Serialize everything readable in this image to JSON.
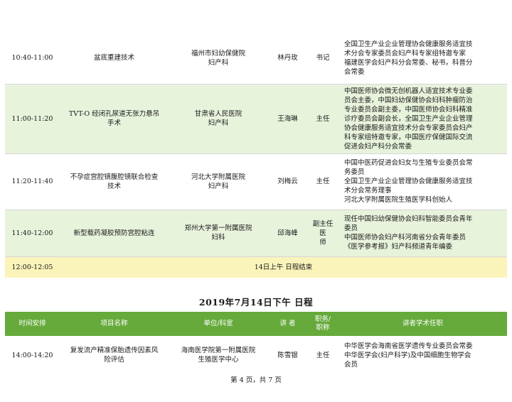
{
  "morning_rows": [
    {
      "time": "10:40-11:00",
      "topic": "盆底重建技术",
      "unit_1": "福州市妇幼保健院",
      "unit_2": "妇产科",
      "name": "林丹玫",
      "position_1": "书记",
      "position_2": "",
      "bio": [
        "全国卫生产业企业管理协会健康服务适宜技",
        "术分会专家委员会妇产科专家组特邀专家",
        "福建医学会妇产科分会常委、秘书，科普分",
        "会常委"
      ]
    },
    {
      "time": "11:00-11:20",
      "topic_1": "TVT-O 经闭孔尿道无张力悬吊",
      "topic_2": "手术",
      "unit_1": "甘肃省人民医院",
      "unit_2": "妇产科",
      "name": "王海琳",
      "position_1": "主任",
      "position_2": "",
      "bio": [
        "中国医师协会微无创机器人适宜技术专业委",
        "员会主委，中国妇幼保健协会妇科肿瘤防治",
        "专业委员会副主委，中国医师协会妇科精准",
        "诊疗委员会副会长，全国卫生产业企业管理",
        "协会健康服务适宜技术分会专家委员会妇产",
        "科专家组特邀专家，中国医疗保健国际交流",
        "促进会妇产科分会常委"
      ]
    },
    {
      "time": "11:20-11:40",
      "topic_1": "不孕症宫腔镜腹腔镜联合检查",
      "topic_2": "技术",
      "unit_1": "河北大学附属医院",
      "unit_2": "妇产科",
      "name": "刘梅云",
      "position_1": "主任",
      "position_2": "",
      "bio": [
        "中国中医药促进会妇女与生殖专业委员会常",
        "务委员",
        "全国卫生产业企业管理协会健康服务适宜技",
        "术分会常务理事",
        "河北大学附属医院生殖医学科创始人"
      ]
    },
    {
      "time": "11:40-12:00",
      "topic": "新型载药凝胶预防宫腔粘连",
      "unit_1": "郑州大学第一附属医院",
      "unit_2": "妇科",
      "name": "邱海峰",
      "position_1": "副主任医",
      "position_2": "师",
      "bio": [
        "现任中国妇幼保健协会妇科智能委员会青年",
        "委员",
        "中国医师协会妇产科河南省分会青年委员",
        "《医学参考报》妇产科频道青年编委"
      ]
    }
  ],
  "end_row": {
    "time": "12:00-12:05",
    "text": "14日上午 日程结束"
  },
  "afternoon_title": "2019年7月14日下午  日程",
  "header": {
    "time": "时间安排",
    "topic": "项目名称",
    "unit": "单位/科室",
    "name": "讲  者",
    "position_1": "职务/",
    "position_2": "职称",
    "bio": "讲者学术任职"
  },
  "afternoon_rows": [
    {
      "time": "14:00-14:20",
      "topic_1": "复发流产精准保胎遗传因素风",
      "topic_2": "险评估",
      "unit_1": "海南医学院第一附属医院",
      "unit_2": "生殖医学中心",
      "name": "陈雪银",
      "position_1": "主任",
      "position_2": "",
      "bio": [
        "中华医学会海南省医学遗传专业委员会常委",
        "中华医学会(妇产科学)及中国细胞生物学会",
        "会员"
      ]
    }
  ],
  "footer": "第 4 页，共 7 页"
}
